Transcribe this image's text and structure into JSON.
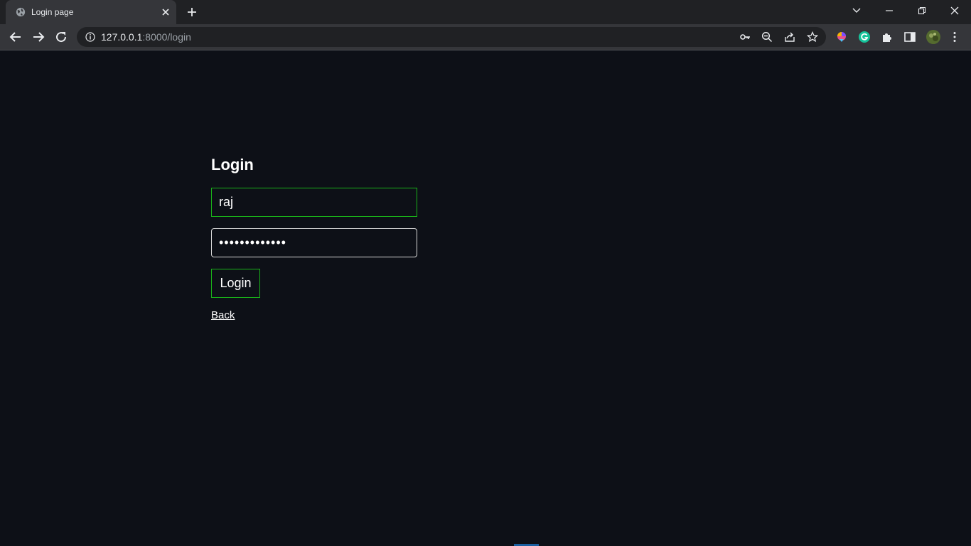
{
  "browser": {
    "tab_title": "Login page",
    "url_host": "127.0.0.1",
    "url_rest": ":8000/login"
  },
  "login": {
    "title": "Login",
    "username_value": "raj",
    "password_value": "•••••••••••••",
    "button_label": "Login",
    "back_label": "Back"
  },
  "colors": {
    "page_background": "#0d1017",
    "accent_green": "#19b219",
    "text": "#ffffff"
  }
}
